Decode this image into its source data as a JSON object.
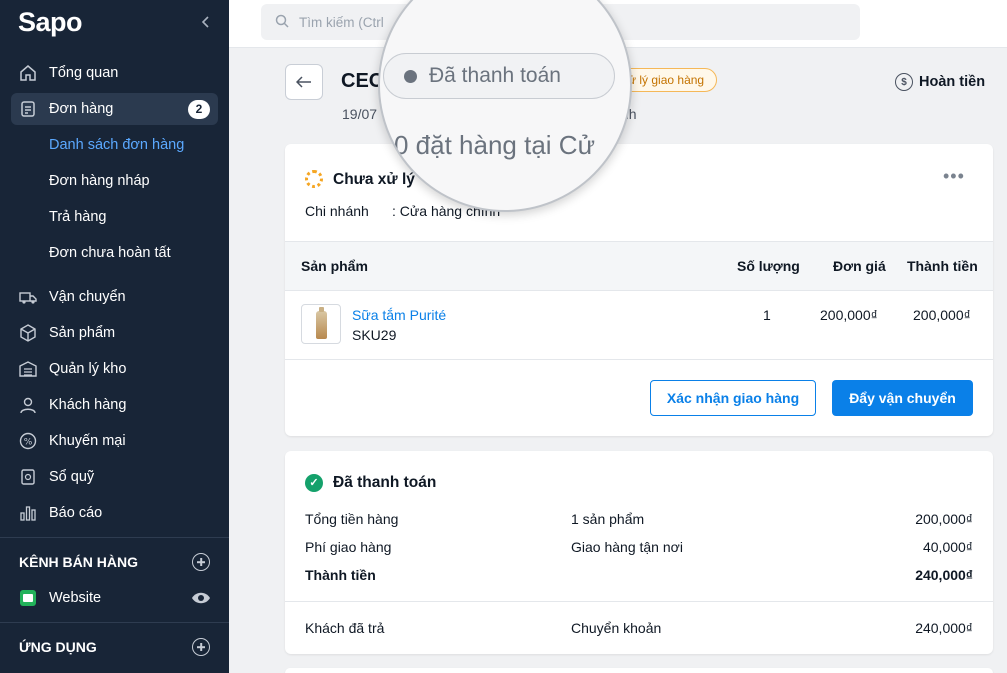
{
  "sidebar": {
    "logo": "Sapo",
    "collapse_icon": "chevron-left-icon",
    "items": [
      {
        "label": "Tổng quan",
        "icon": "home-icon"
      },
      {
        "label": "Đơn hàng",
        "icon": "order-icon",
        "badge": "2"
      },
      {
        "label": "Vận chuyển",
        "icon": "truck-icon"
      },
      {
        "label": "Sản phẩm",
        "icon": "box-icon"
      },
      {
        "label": "Quản lý kho",
        "icon": "warehouse-icon"
      },
      {
        "label": "Khách hàng",
        "icon": "user-icon"
      },
      {
        "label": "Khuyến mại",
        "icon": "percent-icon"
      },
      {
        "label": "Sổ quỹ",
        "icon": "cashbook-icon"
      },
      {
        "label": "Báo cáo",
        "icon": "chart-icon"
      }
    ],
    "sub_items": [
      {
        "label": "Danh sách đơn hàng"
      },
      {
        "label": "Đơn hàng nháp"
      },
      {
        "label": "Trả hàng"
      },
      {
        "label": "Đơn chưa hoàn tất"
      }
    ],
    "sales_channel_title": "KÊNH BÁN HÀNG",
    "website_label": "Website",
    "apps_title": "ỨNG DỤNG"
  },
  "topbar": {
    "search_placeholder": "Tìm kiếm (Ctrl"
  },
  "header": {
    "order_code": "CEO",
    "status_pill": "xử lý giao hàng",
    "meta_date": "19/07",
    "meta_branch": "nh",
    "refund_label": "Hoàn tiền"
  },
  "magnifier": {
    "pill_text": "Đã thanh toán",
    "text": "0 đặt hàng tại Cử"
  },
  "fulfillment": {
    "title": "Chưa xử lý",
    "branch_label": "Chi nhánh",
    "branch_value": ": Cửa hàng chính",
    "columns": [
      "Sản phẩm",
      "Số lượng",
      "Đơn giá",
      "Thành tiền"
    ],
    "product": {
      "name": "Sữa tắm Purité",
      "sku": "SKU29",
      "qty": "1",
      "unit_price": "200,000₫",
      "total": "200,000₫"
    },
    "confirm_button": "Xác nhận giao hàng",
    "ship_button": "Đẩy vận chuyển"
  },
  "payment": {
    "title": "Đã thanh toán",
    "rows": [
      {
        "label": "Tổng tiền hàng",
        "mid": "1 sản phẩm",
        "value": "200,000₫"
      },
      {
        "label": "Phí giao hàng",
        "mid": "Giao hàng tận nơi",
        "value": "40,000₫"
      },
      {
        "label": "Thành tiền",
        "mid": "",
        "value": "240,000₫"
      },
      {
        "label": "Khách đã trả",
        "mid": "Chuyển khoản",
        "value": "240,000₫"
      }
    ]
  },
  "colors": {
    "sidebar_bg": "#182537",
    "primary": "#0a80e8",
    "success": "#14a16b",
    "warning": "#f5a623"
  }
}
